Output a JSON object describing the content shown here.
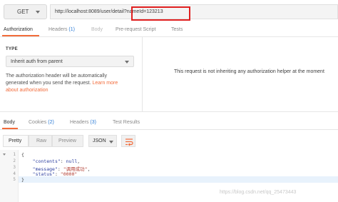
{
  "request": {
    "method": "GET",
    "url": "http://localhost:8089/user/detail?nameId=123213"
  },
  "request_tabs": {
    "authorization": "Authorization",
    "headers": "Headers",
    "headers_count": "(1)",
    "body": "Body",
    "pre_request_script": "Pre-request Script",
    "tests": "Tests"
  },
  "auth": {
    "type_label": "TYPE",
    "type_value": "Inherit auth from parent",
    "help_line1": "The authorization header will be automatically",
    "help_line2_prefix": "generated when you send the request.",
    "help_link_part1": "Learn more",
    "help_link_part2": "about authorization",
    "message": "This request is not inheriting any authorization helper at the moment"
  },
  "response_tabs": {
    "body": "Body",
    "cookies": "Cookies",
    "cookies_count": "(2)",
    "headers": "Headers",
    "headers_count": "(3)",
    "test_results": "Test Results"
  },
  "body_toolbar": {
    "pretty": "Pretty",
    "raw": "Raw",
    "preview": "Preview",
    "format": "JSON"
  },
  "response_body": {
    "line_numbers": [
      "1",
      "2",
      "3",
      "4",
      "5"
    ],
    "open_brace": "{",
    "close_brace": "}",
    "fields": [
      {
        "key": "\"contents\"",
        "value": "null",
        "suffix": ","
      },
      {
        "key": "\"message\"",
        "value": "\"调用成功\"",
        "suffix": ","
      },
      {
        "key": "\"status\"",
        "value": "\"0000\"",
        "suffix": ""
      }
    ]
  },
  "watermark": "https://blog.csdn.net/qq_25473443",
  "colors": {
    "accent": "#f26b3a",
    "highlight_box": "#e02020",
    "count_blue": "#2b7bd6"
  }
}
